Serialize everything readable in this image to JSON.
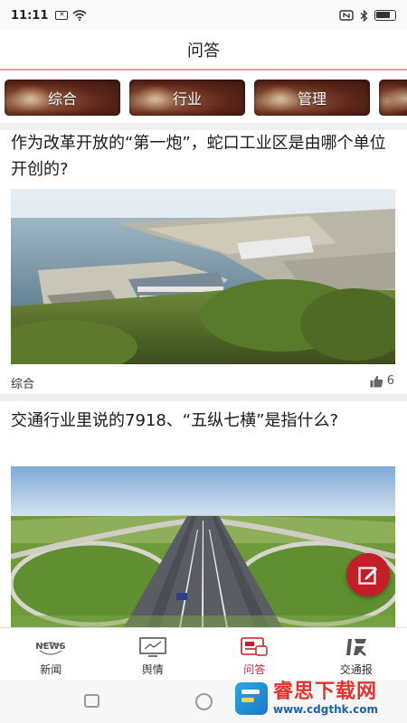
{
  "status_bar": {
    "time": "11:11",
    "icons": [
      "message-box-icon",
      "wifi-icon",
      "nfc-icon",
      "bluetooth-icon",
      "battery-icon"
    ]
  },
  "header": {
    "title": "问答"
  },
  "tabs": [
    {
      "label": "综合"
    },
    {
      "label": "行业"
    },
    {
      "label": "管理"
    },
    {
      "label": ""
    }
  ],
  "articles": [
    {
      "title": "作为改革开放的“第一炮”，蛇口工业区是由哪个单位开创的?",
      "category": "综合",
      "likes": "6",
      "image_description_icon": "port-aerial-photo"
    },
    {
      "title": "交通行业里说的7918、“五纵七横”是指什么?",
      "image_description_icon": "highway-interchange-photo"
    }
  ],
  "bottom_nav": [
    {
      "label": "新闻",
      "icon": "news-icon"
    },
    {
      "label": "舆情",
      "icon": "monitor-icon"
    },
    {
      "label": "问答",
      "icon": "qa-icon",
      "active": true
    },
    {
      "label": "交通报",
      "icon": "newspaper-icon"
    }
  ],
  "watermark": {
    "main": "睿思下载网",
    "url": "www.cdgthk.com"
  },
  "colors": {
    "accent": "#c41f28",
    "header_rule": "#e9a0a0",
    "tab_bg": "#5a2418"
  }
}
